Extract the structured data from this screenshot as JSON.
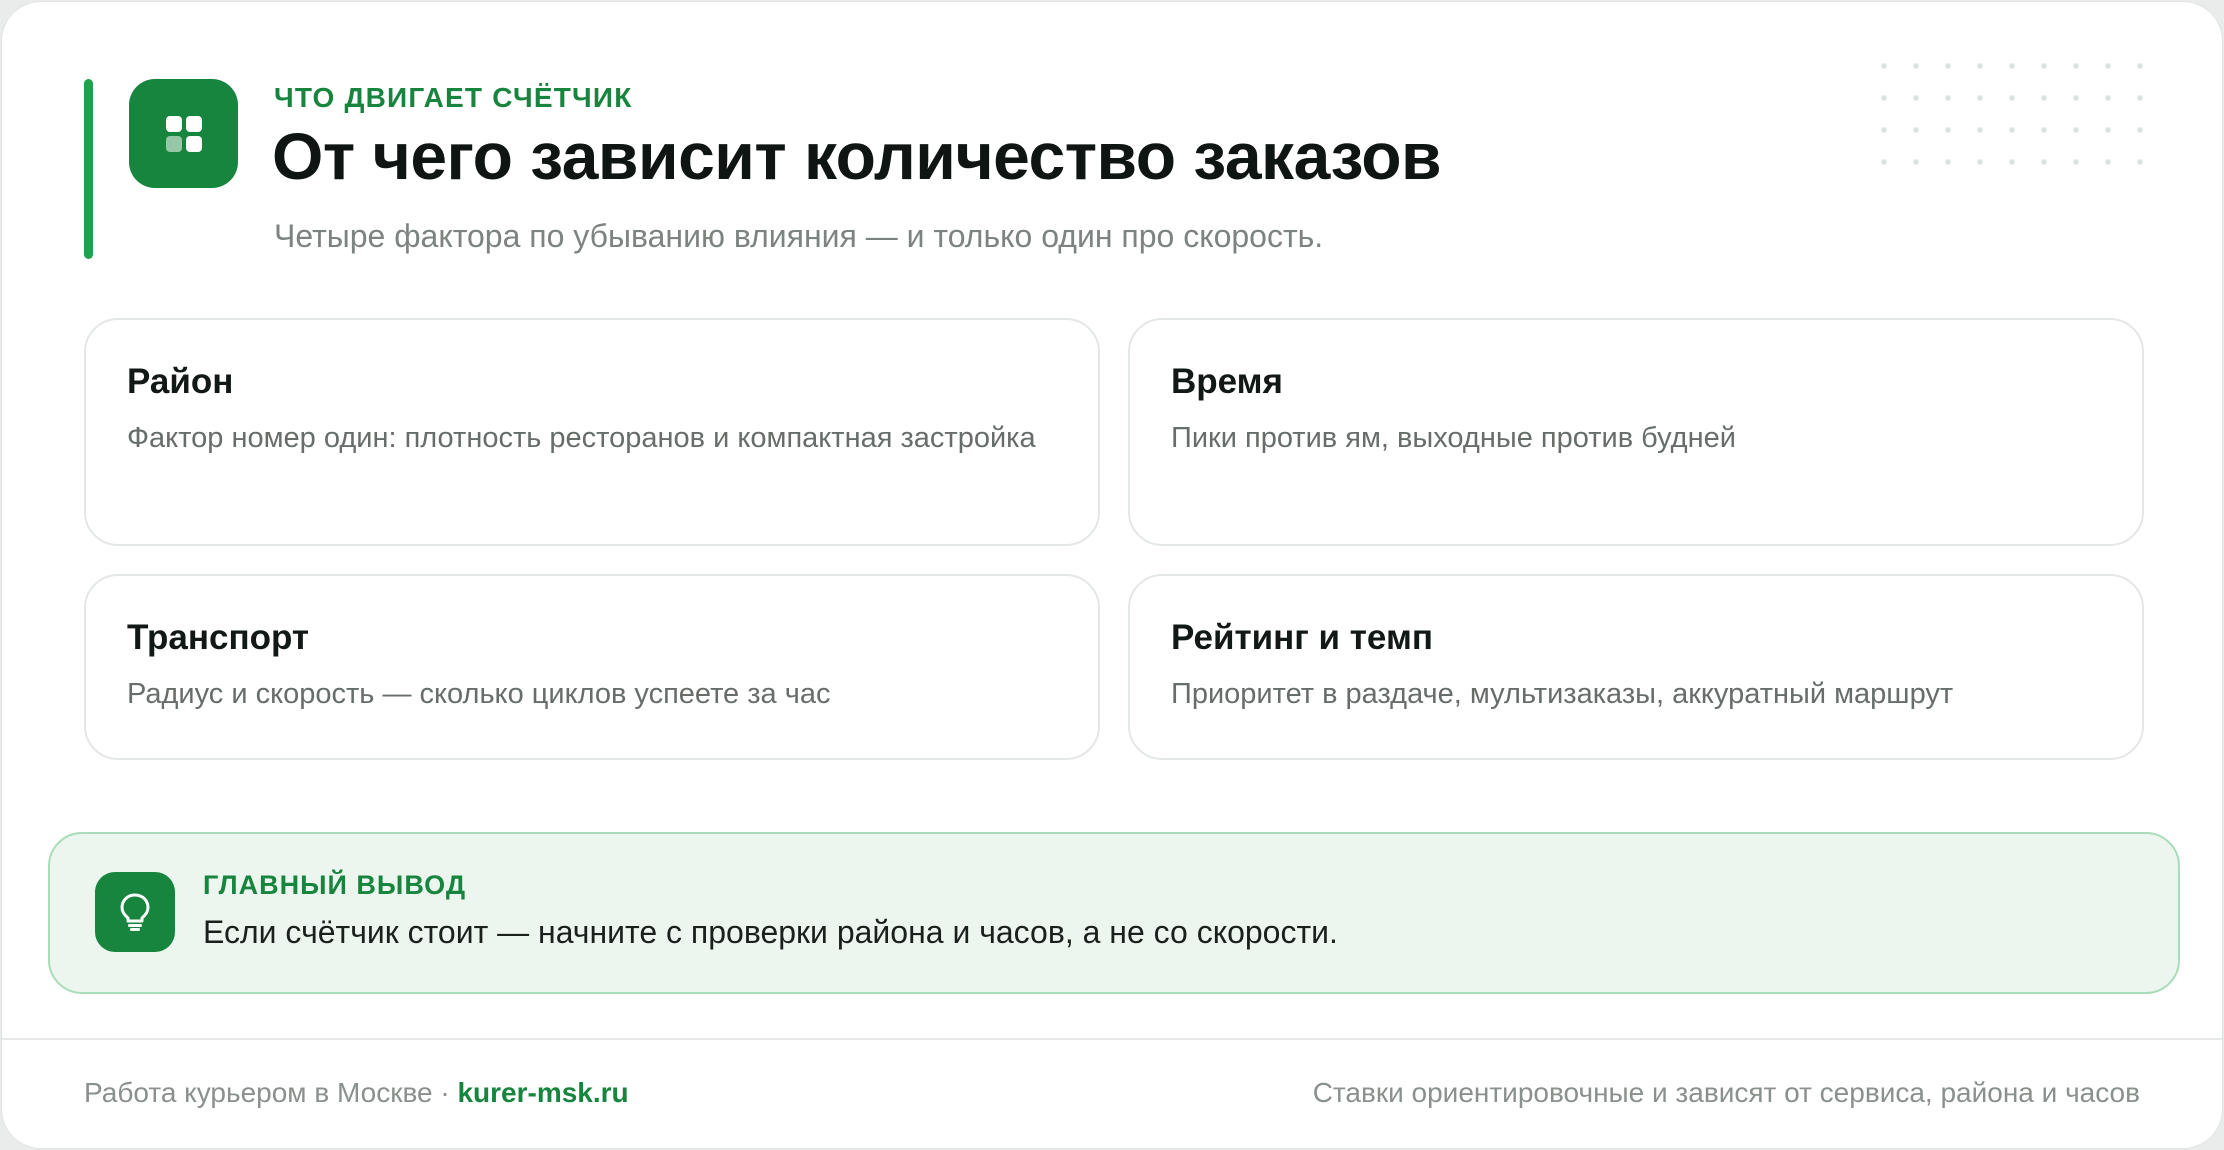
{
  "header": {
    "eyebrow": "ЧТО ДВИГАЕТ СЧЁТЧИК",
    "title": "От чего зависит количество заказов",
    "subtitle": "Четыре фактора по убыванию влияния — и только один про скорость.",
    "logo_icon": "grid-icon"
  },
  "factors": [
    {
      "title": "Район",
      "description": "Фактор номер один: плотность ресторанов и компактная застройка"
    },
    {
      "title": "Время",
      "description": "Пики против ям, выходные против будней"
    },
    {
      "title": "Транспорт",
      "description": "Радиус и скорость — сколько циклов успеете за час"
    },
    {
      "title": "Рейтинг и темп",
      "description": "Приоритет в раздаче, мультизаказы, аккуратный маршрут"
    }
  ],
  "takeaway": {
    "icon": "lightbulb-icon",
    "label": "ГЛАВНЫЙ ВЫВОД",
    "text": "Если счётчик стоит — начните с проверки района и часов, а не со скорости."
  },
  "footer": {
    "left_text": "Работа курьером в Москве · ",
    "site": "kurer-msk.ru",
    "right_text": "Ставки ориентировочные и зависят от сервиса, района и часов"
  },
  "colors": {
    "brand_green": "#17853d",
    "accent_green": "#1fa24d",
    "takeaway_bg": "#ecf6ef",
    "takeaway_border": "#a9dcb8"
  }
}
